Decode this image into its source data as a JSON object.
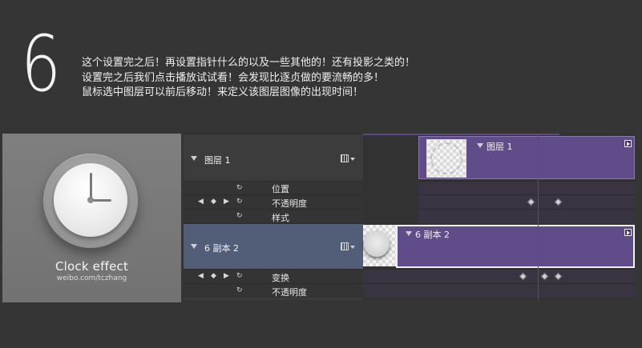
{
  "step": {
    "number": "6"
  },
  "instructions": {
    "line1": "这个设置完之后！再设置指针什么的以及一些其他的！还有投影之类的！",
    "line2": "设置完之后我们点击播放试试看！会发现比逐贞做的要流畅的多！",
    "line3": "鼠标选中图层可以前后移动！来定义该图层图像的出现时间！"
  },
  "preview": {
    "title": "Clock effect",
    "subtitle": "weibo.com/tczhang"
  },
  "timeline": {
    "layers": [
      {
        "name": "图层 1",
        "bar_label": "图层 1",
        "properties": [
          "位置",
          "不透明度",
          "样式"
        ]
      },
      {
        "name": "6 副本 2",
        "bar_label": "6 副本 2",
        "properties": [
          "变换",
          "不透明度"
        ]
      }
    ],
    "accent_color": "#614c8a",
    "selected_row_color": "#525d78",
    "playhead_color": "#c0262c"
  }
}
